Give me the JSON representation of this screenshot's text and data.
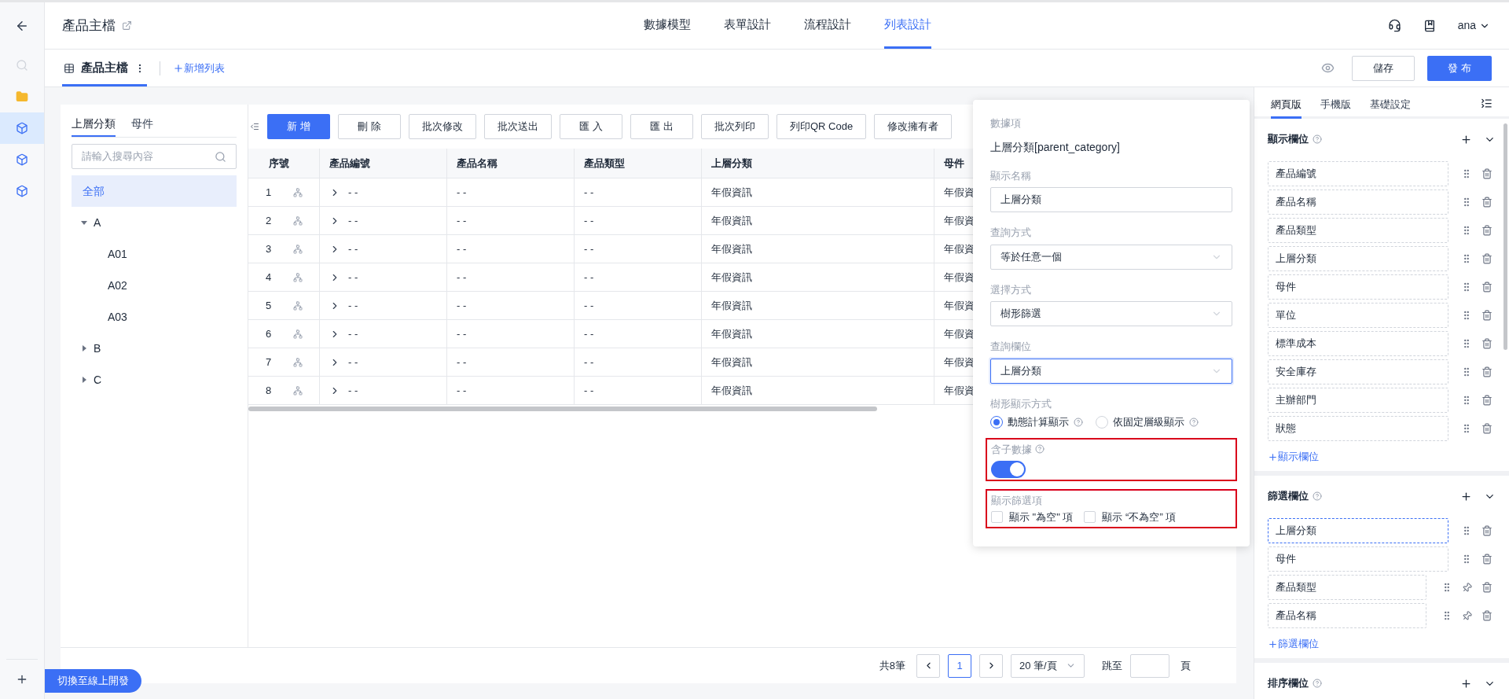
{
  "rail": {
    "items": [
      {
        "kind": "search",
        "selected": false
      },
      {
        "kind": "folder",
        "selected": false
      },
      {
        "kind": "cube",
        "selected": true
      },
      {
        "kind": "cube",
        "selected": false
      },
      {
        "kind": "cube",
        "selected": false
      }
    ]
  },
  "header": {
    "title": "產品主檔",
    "tabs": [
      {
        "label": "數據模型",
        "selected": false
      },
      {
        "label": "表單設計",
        "selected": false
      },
      {
        "label": "流程設計",
        "selected": false
      },
      {
        "label": "列表設計",
        "selected": true
      }
    ],
    "user": "ana"
  },
  "subbar": {
    "list_tab": "產品主檔",
    "add_list": "新增列表",
    "save": "儲存",
    "publish": "發 布"
  },
  "tree": {
    "tabs": [
      {
        "label": "上層分類",
        "selected": true
      },
      {
        "label": "母件",
        "selected": false
      }
    ],
    "search": {
      "placeholder": "請輸入搜尋內容"
    },
    "nodes": [
      {
        "label": "全部",
        "selected": true
      },
      {
        "label": "A",
        "selected": false,
        "expanded": true,
        "children": [
          {
            "label": "A01",
            "selected": false
          },
          {
            "label": "A02",
            "selected": false
          },
          {
            "label": "A03",
            "selected": false
          }
        ]
      },
      {
        "label": "B",
        "selected": false,
        "expanded": false
      },
      {
        "label": "C",
        "selected": false,
        "expanded": false
      }
    ]
  },
  "toolbar": {
    "buttons": [
      {
        "label": "新 增",
        "kind": "primary"
      },
      {
        "label": "刪 除",
        "kind": "default"
      },
      {
        "label": "批次修改",
        "kind": "default"
      },
      {
        "label": "批次送出",
        "kind": "default"
      },
      {
        "label": "匯 入",
        "kind": "default"
      },
      {
        "label": "匯 出",
        "kind": "default"
      },
      {
        "label": "批次列印",
        "kind": "default"
      },
      {
        "label": "列印QR Code",
        "kind": "default"
      },
      {
        "label": "修改擁有者",
        "kind": "default"
      }
    ]
  },
  "table": {
    "columns": [
      "序號",
      "產品編號",
      "產品名稱",
      "產品類型",
      "上層分類",
      "母件"
    ],
    "rows": [
      {
        "cells": [
          "1",
          "- -",
          "- -",
          "- -",
          "年假資訊",
          "年假資"
        ]
      },
      {
        "cells": [
          "2",
          "- -",
          "- -",
          "- -",
          "年假資訊",
          "年假資"
        ]
      },
      {
        "cells": [
          "3",
          "- -",
          "- -",
          "- -",
          "年假資訊",
          "年假資"
        ]
      },
      {
        "cells": [
          "4",
          "- -",
          "- -",
          "- -",
          "年假資訊",
          "年假資"
        ]
      },
      {
        "cells": [
          "5",
          "- -",
          "- -",
          "- -",
          "年假資訊",
          "年假資"
        ]
      },
      {
        "cells": [
          "6",
          "- -",
          "- -",
          "- -",
          "年假資訊",
          "年假資"
        ]
      },
      {
        "cells": [
          "7",
          "- -",
          "- -",
          "- -",
          "年假資訊",
          "年假資"
        ]
      },
      {
        "cells": [
          "8",
          "- -",
          "- -",
          "- -",
          "年假資訊",
          "年假資"
        ]
      }
    ]
  },
  "pagination": {
    "total": "共8筆",
    "pages": [
      {
        "label": "1",
        "selected": true
      }
    ],
    "page_size": "20 筆/頁",
    "jump_label": "跳至",
    "page_suffix": "頁"
  },
  "switch_button": "切換至線上開發",
  "popover": {
    "data_item_label": "數據項",
    "data_item": "上層分類[parent_category]",
    "fields": [
      {
        "label": "顯示名稱",
        "kind": "input",
        "value": "上層分類",
        "focused": false
      },
      {
        "label": "查詢方式",
        "kind": "select",
        "value": "等於任意一個",
        "focused": false
      },
      {
        "label": "選擇方式",
        "kind": "select",
        "value": "樹形篩選",
        "focused": false
      },
      {
        "label": "查詢欄位",
        "kind": "select",
        "value": "上層分類",
        "focused": true
      }
    ],
    "tree_mode": {
      "label": "樹形顯示方式",
      "options": [
        {
          "label": "動態計算顯示",
          "selected": true
        },
        {
          "label": "依固定層級顯示",
          "selected": false
        }
      ]
    },
    "include_children": {
      "label": "含子數據",
      "on": true,
      "highlighted": true
    },
    "filter_options": {
      "label": "顯示篩選項",
      "highlighted": true,
      "options": [
        {
          "label": "顯示 \"為空\" 項",
          "checked": false
        },
        {
          "label": "顯示 “不為空” 項",
          "checked": false
        }
      ]
    }
  },
  "side_panel": {
    "tabs": [
      {
        "label": "網頁版",
        "selected": true
      },
      {
        "label": "手機版",
        "selected": false
      },
      {
        "label": "基礎設定",
        "selected": false
      }
    ],
    "display_fields": {
      "title": "顯示欄位",
      "add": "顯示欄位",
      "items": [
        {
          "label": "產品編號",
          "kind": "plain",
          "selected": false
        },
        {
          "label": "產品名稱",
          "kind": "plain",
          "selected": false
        },
        {
          "label": "產品類型",
          "kind": "plain",
          "selected": false
        },
        {
          "label": "上層分類",
          "kind": "plain",
          "selected": false
        },
        {
          "label": "母件",
          "kind": "plain",
          "selected": false
        },
        {
          "label": "單位",
          "kind": "plain",
          "selected": false
        },
        {
          "label": "標準成本",
          "kind": "plain",
          "selected": false
        },
        {
          "label": "安全庫存",
          "kind": "plain",
          "selected": false
        },
        {
          "label": "主辦部門",
          "kind": "plain",
          "selected": false
        },
        {
          "label": "狀態",
          "kind": "plain",
          "selected": false
        }
      ]
    },
    "filter_fields": {
      "title": "篩選欄位",
      "add": "篩選欄位",
      "items": [
        {
          "label": "上層分類",
          "kind": "plain",
          "selected": true
        },
        {
          "label": "母件",
          "kind": "plain",
          "selected": false
        },
        {
          "label": "產品類型",
          "kind": "pinnable",
          "selected": false
        },
        {
          "label": "產品名稱",
          "kind": "pinnable",
          "selected": false
        }
      ]
    },
    "sort_fields": {
      "title": "排序欄位"
    }
  }
}
